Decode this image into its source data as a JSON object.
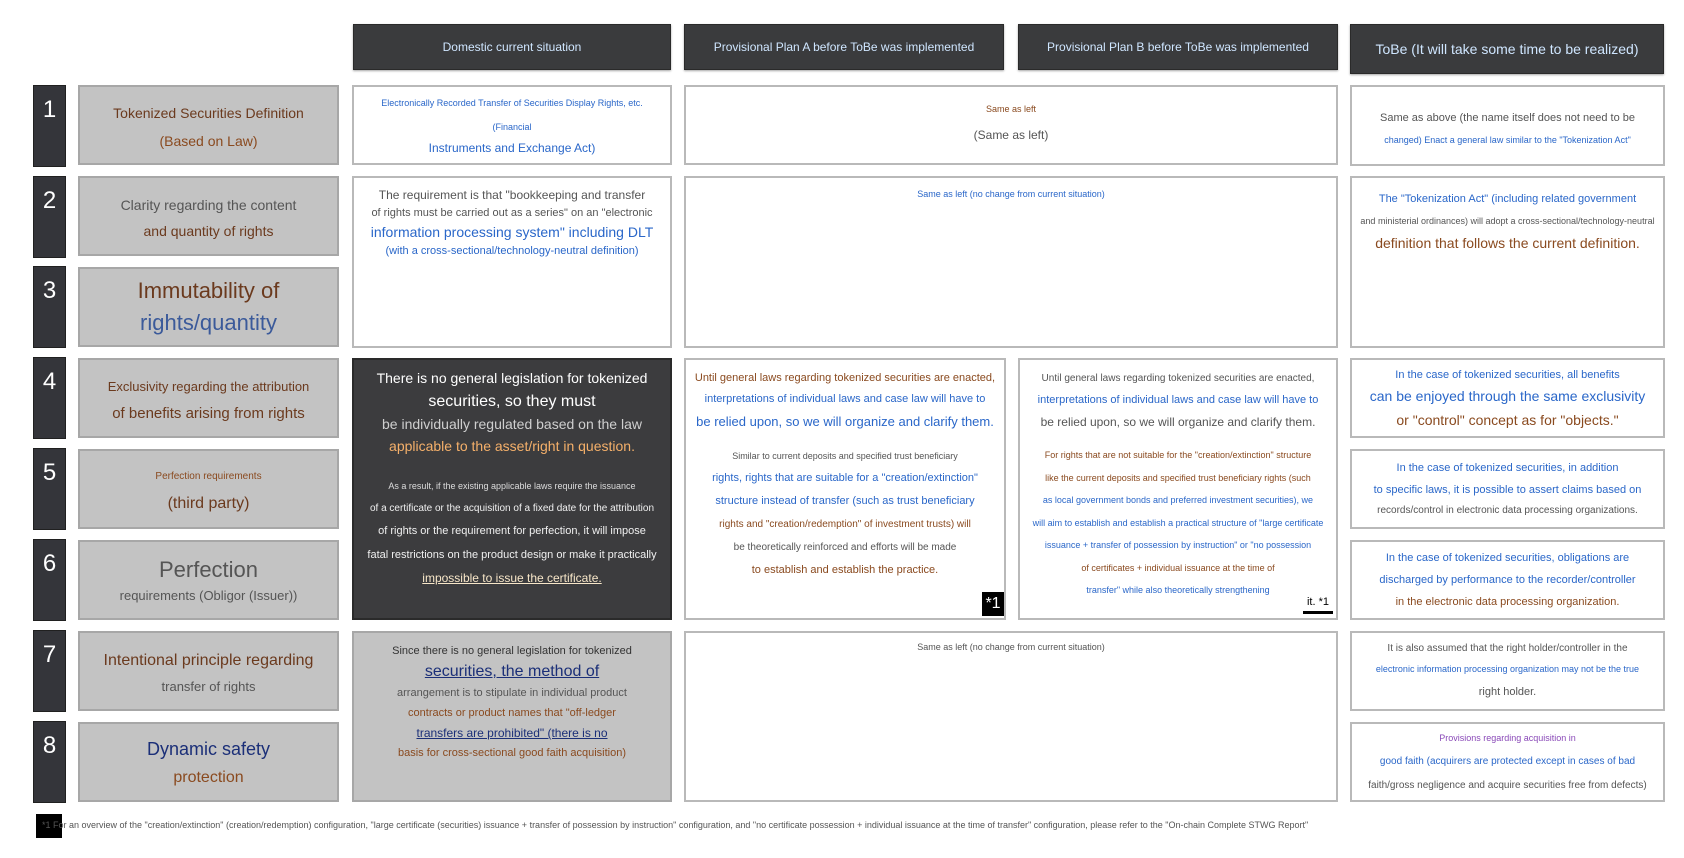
{
  "headers": {
    "current": "Domestic current situation",
    "plan_a": "Provisional Plan A before ToBe was implemented",
    "plan_b": "Provisional Plan B before ToBe was implemented",
    "tobe": "ToBe (It will take some time to be realized)"
  },
  "rows": [
    {
      "num": "1",
      "label_1": "Tokenized Securities Definition",
      "label_2": "(Based on Law)"
    },
    {
      "num": "2",
      "label_1": "Clarity regarding the content",
      "label_2": "and quantity of rights"
    },
    {
      "num": "3",
      "label_1": "Immutability of",
      "label_2": "rights/quantity"
    },
    {
      "num": "4",
      "label_1": "Exclusivity regarding the attribution",
      "label_2": "of benefits arising from rights"
    },
    {
      "num": "5",
      "label_1": "Perfection requirements",
      "label_2": "(third party)"
    },
    {
      "num": "6",
      "label_1": "Perfection",
      "label_2": "requirements (Obligor (Issuer))"
    },
    {
      "num": "7",
      "label_1": "Intentional principle regarding",
      "label_2": "transfer of rights"
    },
    {
      "num": "8",
      "label_1": "Dynamic safety",
      "label_2": "protection"
    }
  ],
  "current": {
    "r1": [
      "Electronically Recorded Transfer of Securities Display Rights, etc. (Financial",
      "Instruments and Exchange Act)"
    ],
    "r23": [
      "The requirement is that \"bookkeeping and transfer",
      "of rights must be carried out as a series\" on an \"electronic",
      "information processing system\" including DLT",
      "(with a cross-sectional/technology-neutral definition)"
    ],
    "r456": [
      "There is no general legislation for tokenized",
      "securities, so they must",
      "be individually regulated based on the law",
      "applicable to the asset/right in question.",
      "As a result, if the existing applicable laws require the issuance",
      "of a certificate or the acquisition of a fixed date for the attribution",
      "of rights or the requirement for perfection, it will impose",
      "fatal restrictions on the product design or make it practically",
      "impossible to issue the certificate."
    ],
    "r78": [
      "Since there is no general legislation for tokenized",
      "securities, the method of",
      "arrangement is to stipulate in individual product",
      "contracts or product names that \"off-ledger",
      "transfers are prohibited\" (there is no",
      "basis for cross-sectional good faith acquisition)"
    ]
  },
  "plan_ab": {
    "r1": [
      "Same as left",
      "(Same as left)"
    ],
    "r23": "Same as left (no change from current situation)",
    "r78": "Same as left (no change from current situation)"
  },
  "plan_a": {
    "r456": [
      "Until general laws regarding tokenized securities are enacted,",
      "interpretations of individual laws and case law will have to",
      "be relied upon, so we will organize and clarify them.",
      "Similar to current deposits and specified trust beneficiary",
      "rights, rights that are suitable for a \"creation/extinction\"",
      "structure instead of transfer (such as trust beneficiary",
      "rights and \"creation/redemption\" of investment trusts) will",
      "be theoretically reinforced and efforts will be made",
      "to establish and establish the practice."
    ],
    "note": "*1"
  },
  "plan_b": {
    "r456": [
      "Until general laws regarding tokenized securities are enacted,",
      "interpretations of individual laws and case law will have to",
      "be relied upon, so we will organize and clarify them.",
      "For rights that are not suitable for the \"creation/extinction\" structure",
      "like the current deposits and specified trust beneficiary rights (such",
      "as local government bonds and preferred investment securities), we",
      "will aim to establish and establish a practical structure of \"large certificate",
      "issuance + transfer of possession by instruction\" or \"no possession",
      "of certificates + individual issuance at the time of",
      "transfer\" while also theoretically strengthening"
    ],
    "note": "it. *1"
  },
  "tobe": {
    "r1": [
      "Same as above (the name itself does not need to be",
      "changed) Enact a general law similar to the \"Tokenization Act\""
    ],
    "r23": [
      "The \"Tokenization Act\" (including related government",
      "and ministerial ordinances) will adopt a cross-sectional/technology-neutral",
      "definition that follows the current definition."
    ],
    "r4": [
      "In the case of tokenized securities, all benefits",
      "can be enjoyed through the same exclusivity",
      "or \"control\" concept as for \"objects.\""
    ],
    "r5": [
      "In the case of tokenized securities, in addition",
      "to specific laws, it is possible to assert claims based on",
      "records/control in electronic data processing organizations."
    ],
    "r6": [
      "In the case of tokenized securities, obligations are",
      "discharged by performance to the recorder/controller",
      "in the electronic data processing organization."
    ],
    "r7": [
      "It is also assumed that the right holder/controller in the",
      "electronic information processing organization may not be the true",
      "right holder."
    ],
    "r8": [
      "Provisions regarding acquisition in",
      "good faith (acquirers are protected except in cases of bad",
      "faith/gross negligence and acquire securities free from defects)"
    ]
  },
  "footnote": "*1 For an overview of the \"creation/extinction\" (creation/redemption) configuration, \"large certificate (securities) issuance + transfer of possession by instruction\" configuration, and \"no certificate possession + individual issuance at the time of transfer\" configuration, please refer to the \"On-chain Complete STWG Report\""
}
